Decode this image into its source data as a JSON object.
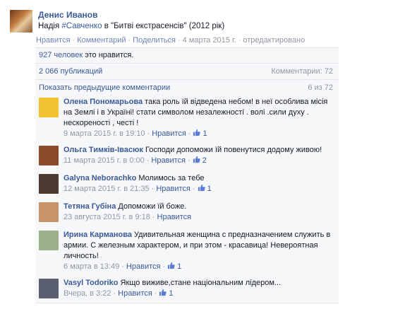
{
  "post": {
    "author": "Денис Иванов",
    "text_before": "Надія ",
    "hashtag": "#Савченко",
    "text_after": " в \"Битві екстрасенсів\" (2012 рік)",
    "actions": [
      "Нравится",
      "Комментарий",
      "Поделиться"
    ],
    "date": "4 марта 2015 г.",
    "edited": "отредактировано"
  },
  "ufi": {
    "likes_count": "927 человек",
    "likes_text": " это нравится.",
    "shares": "2 066 публикаций",
    "comments_label": "Комментарии: 72",
    "prev_comments": "Показать предыдущие комментарии",
    "prev_count": "6 из 72"
  },
  "comments": [
    {
      "name": "Олена Пономарьова",
      "text": "така роль їй відведена небом! в неї особлива місія на Землі і в Україні! стати символом незалежності . волі .сили духу . нескореності , честі !",
      "date": "9 марта 2015 г. в 19:10",
      "like": "Нравится",
      "likes": "1",
      "avatar_color": "#f2c230"
    },
    {
      "name": "Ольга Тимків-Івасюк",
      "text": "Господи допоможи їй повенутися додому живою!",
      "date": "11 марта 2015 г. в 0:00",
      "like": "Нравится",
      "likes": "2",
      "avatar_color": "#8a4a2a"
    },
    {
      "name": "Galyna Neborachko",
      "text": "Молимось за тебе",
      "date": "12 марта 2015 г. в 21:35",
      "like": "Нравится",
      "likes": "1",
      "avatar_color": "#4a3a30"
    },
    {
      "name": "Тетяна Губіна",
      "text": "Допоможи їй боже.",
      "date": "23 августа 2015 г. в 9:18",
      "like": "Нравится",
      "likes": "",
      "avatar_color": "#c8926a"
    },
    {
      "name": "Ирина Карманова",
      "text": "Удивительная женщина с предназначением служить в армии. С железным характером, и при этом - красавица! Невероятная личность!",
      "date": "6 марта в 13:49",
      "like": "Нравится",
      "likes": "1",
      "avatar_color": "#9ab08a"
    },
    {
      "name": "Vasyl Todoriko",
      "text": "Якщо виживе,стане національним лідером...",
      "date": "Вчера, в 3:22",
      "like": "Нравится",
      "likes": "1",
      "avatar_color": "#5a6070"
    }
  ]
}
